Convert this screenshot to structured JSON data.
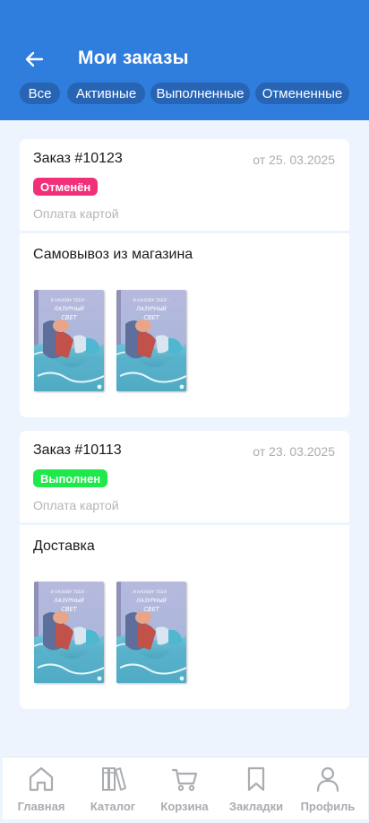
{
  "header": {
    "title": "Мои заказы",
    "back_icon": "arrow-left-icon",
    "background": "#2f7ddc"
  },
  "tabs": [
    {
      "label": "Все"
    },
    {
      "label": "Активные"
    },
    {
      "label": "Выполненные"
    },
    {
      "label": "Отмененные"
    }
  ],
  "orders": [
    {
      "number": "Заказ #10123",
      "date": "от 25. 03.2025",
      "status": "Отменён",
      "status_color": "#f2307a",
      "payment": "Оплата картой",
      "delivery": "Самовывоз из магазина",
      "books": [
        {
          "title": "Я НАЗОВУ ТЕБЯ – ЛАЗУРНЫЙ СВЕТ"
        },
        {
          "title": "Я НАЗОВУ ТЕБЯ – ЛАЗУРНЫЙ СВЕТ"
        }
      ]
    },
    {
      "number": "Заказ #10113",
      "date": "от 23. 03.2025",
      "status": "Выполнен",
      "status_color": "#1ee84a",
      "payment": "Оплата картой",
      "delivery": "Доставка",
      "books": [
        {
          "title": "Я НАЗОВУ ТЕБЯ – ЛАЗУРНЫЙ СВЕТ"
        },
        {
          "title": "Я НАЗОВУ ТЕБЯ – ЛАЗУРНЫЙ СВЕТ"
        }
      ]
    }
  ],
  "bottom_nav": [
    {
      "label": "Главная",
      "icon": "home-icon"
    },
    {
      "label": "Каталог",
      "icon": "catalog-icon"
    },
    {
      "label": "Корзина",
      "icon": "cart-icon"
    },
    {
      "label": "Закладки",
      "icon": "bookmark-icon"
    },
    {
      "label": "Профиль",
      "icon": "profile-icon"
    }
  ]
}
